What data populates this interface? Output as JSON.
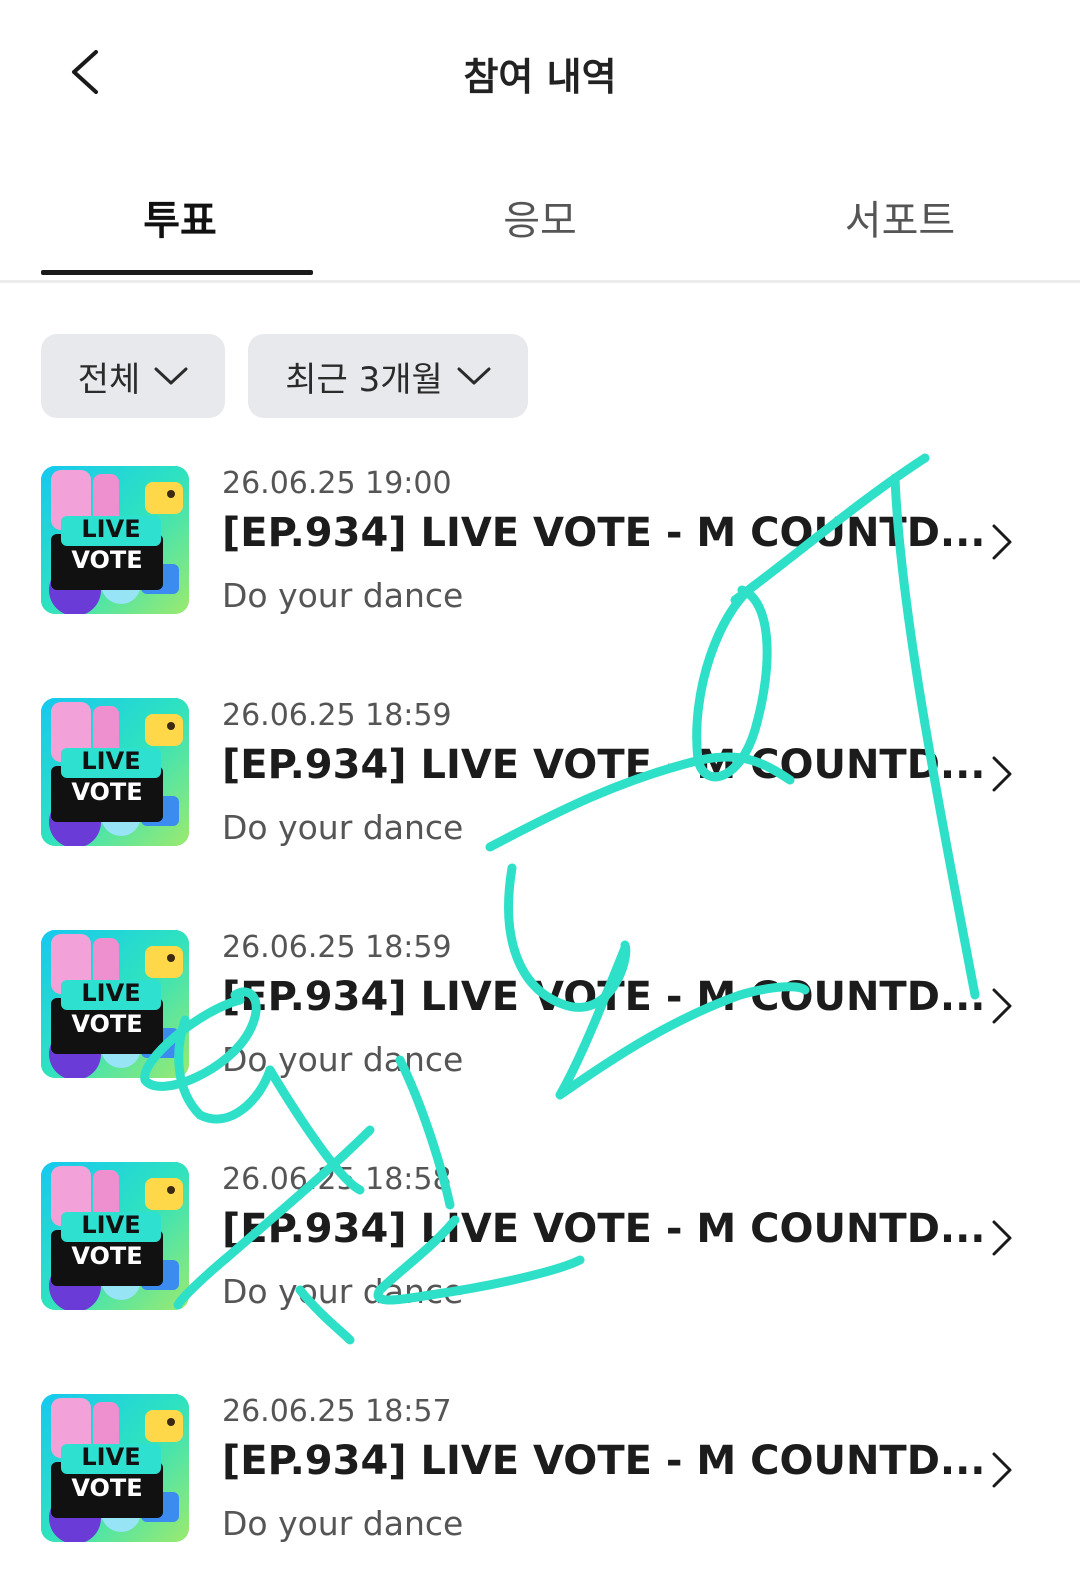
{
  "header": {
    "title": "참여 내역"
  },
  "tabs": [
    {
      "label": "투표",
      "active": true
    },
    {
      "label": "응모",
      "active": false
    },
    {
      "label": "서포트",
      "active": false
    }
  ],
  "filters": [
    {
      "label": "전체"
    },
    {
      "label": "최근 3개월"
    }
  ],
  "thumbnail": {
    "line1": "LIVE",
    "line2": "VOTE"
  },
  "items": [
    {
      "date": "26.06.25 19:00",
      "title": "[EP.934] LIVE VOTE - M COUNTD...",
      "subtitle": "Do your dance"
    },
    {
      "date": "26.06.25 18:59",
      "title": "[EP.934] LIVE VOTE - M COUNTD...",
      "subtitle": "Do your dance"
    },
    {
      "date": "26.06.25 18:59",
      "title": "[EP.934] LIVE VOTE - M COUNTD...",
      "subtitle": "Do your dance"
    },
    {
      "date": "26.06.25 18:58",
      "title": "[EP.934] LIVE VOTE - M COUNTD...",
      "subtitle": "Do your dance"
    },
    {
      "date": "26.06.25 18:57",
      "title": "[EP.934] LIVE VOTE - M COUNTD...",
      "subtitle": "Do your dance"
    }
  ],
  "colors": {
    "scribble": "#2fe0c9",
    "tab_indicator": "#1a1a1a",
    "filter_bg": "#e8e9ec"
  }
}
